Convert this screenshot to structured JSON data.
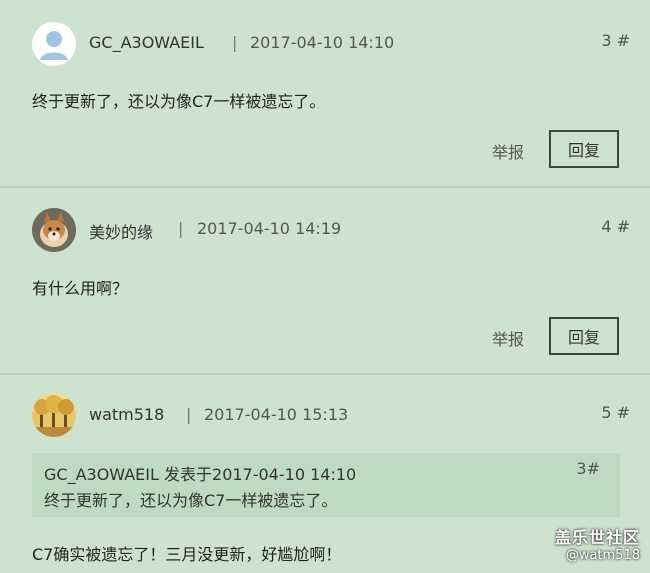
{
  "posts": [
    {
      "username": "GC_A3OWAEIL",
      "separator": "|",
      "time": "2017-04-10 14:10",
      "floor": "3 #",
      "content": "终于更新了，还以为像C7一样被遗忘了。",
      "report_label": "举报",
      "reply_label": "回复",
      "avatar_icon": "default-user-icon"
    },
    {
      "username": "美妙的缘",
      "separator": "|",
      "time": "2017-04-10 14:19",
      "floor": "4 #",
      "content": "有什么用啊？",
      "report_label": "举报",
      "reply_label": "回复",
      "avatar_icon": "dog-photo-avatar"
    },
    {
      "username": "watm518",
      "separator": "|",
      "time": "2017-04-10 15:13",
      "floor": "5 #",
      "quote": {
        "author_line": "GC_A3OWAEIL 发表于2017-04-10 14:10",
        "text": "终于更新了，还以为像C7一样被遗忘了。",
        "floor": "3#"
      },
      "content": "C7确实被遗忘了！三月没更新，好尴尬啊！",
      "avatar_icon": "autumn-trees-avatar"
    }
  ],
  "watermark": {
    "brand": "盖乐世社区",
    "user": "@watm518"
  },
  "colors": {
    "background": "#cde3cf",
    "quote_background": "#bedbc1",
    "divider": "#b9d2bb"
  }
}
